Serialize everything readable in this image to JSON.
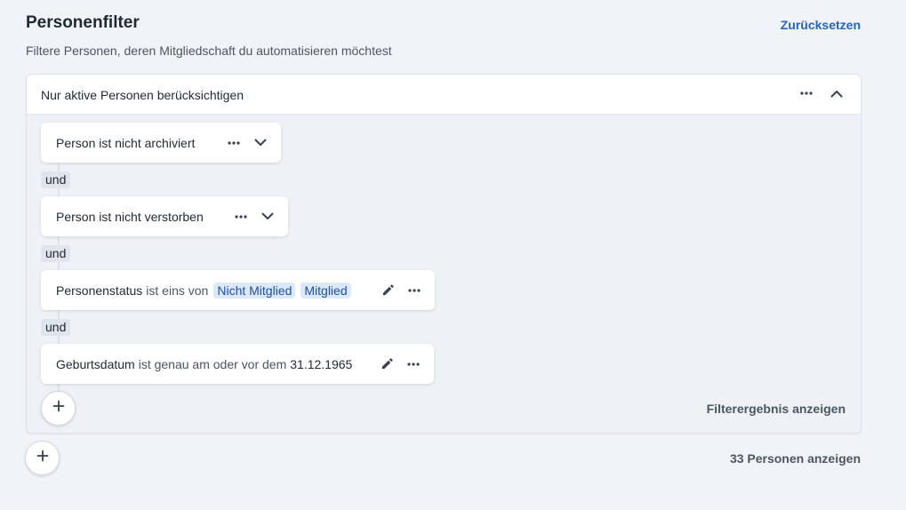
{
  "header": {
    "title": "Personenfilter",
    "subtitle": "Filtere Personen, deren Mitgliedschaft du automatisieren möchtest",
    "reset_label": "Zurücksetzen"
  },
  "group": {
    "label": "Nur aktive Personen berücksichtigen",
    "icons": [
      "more-icon",
      "chevron-up-icon"
    ],
    "conditions": [
      {
        "text": "Person ist nicht archiviert",
        "icons": [
          "more-icon",
          "chevron-down-icon"
        ]
      },
      {
        "text": "Person ist nicht verstorben",
        "icons": [
          "more-icon",
          "chevron-down-icon"
        ]
      },
      {
        "field": "Personenstatus",
        "operator": "ist eins von",
        "chips": [
          "Nicht Mitglied",
          "Mitglied"
        ],
        "icons": [
          "pencil-icon",
          "more-icon"
        ]
      },
      {
        "field": "Geburtsdatum",
        "operator": "ist genau am oder vor dem",
        "value": "31.12.1965",
        "icons": [
          "pencil-icon",
          "more-icon"
        ]
      }
    ],
    "connector_label": "und",
    "show_result_label": "Filterergebnis anzeigen"
  },
  "footer": {
    "show_persons_label": "33 Personen anzeigen"
  },
  "colors": {
    "background": "#f0f3f8",
    "accent": "#2563c9",
    "chip_bg": "#dce8fb",
    "chip_text": "#1e4fa0"
  }
}
